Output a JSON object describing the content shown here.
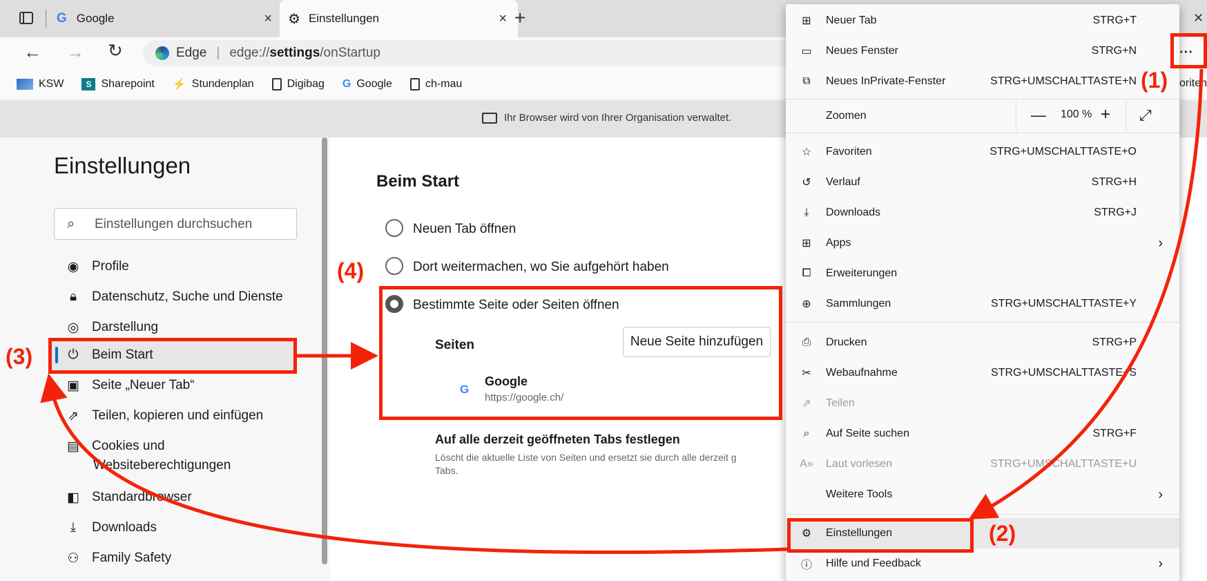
{
  "tabs": [
    {
      "label": "Google",
      "close": "×"
    },
    {
      "label": "Einstellungen",
      "close": "×"
    }
  ],
  "new_tab_symbol": "+",
  "window_close": "✕",
  "address": {
    "brand": "Edge",
    "separator": "|",
    "url_prefix": "edge://",
    "url_bold": "settings",
    "url_rest": "/onStartup"
  },
  "more_button_label": "···",
  "favorites": [
    "KSW",
    "Sharepoint",
    "Stundenplan",
    "Digibag",
    "Google",
    "ch-mau"
  ],
  "favorites_right_cutoff": "voriten",
  "managed_notice": "Ihr Browser wird von Ihrer Organisation verwaltet.",
  "settings": {
    "title": "Einstellungen",
    "search_placeholder": "Einstellungen durchsuchen",
    "nav": [
      {
        "label": "Profile",
        "icon": "profile-icon"
      },
      {
        "label": "Datenschutz, Suche und Dienste",
        "icon": "lock-icon"
      },
      {
        "label": "Darstellung",
        "icon": "palette-icon"
      },
      {
        "label": "Beim Start",
        "icon": "power-icon",
        "active": true
      },
      {
        "label": "Seite „Neuer Tab“",
        "icon": "newtab-icon"
      },
      {
        "label": "Teilen, kopieren und einfügen",
        "icon": "share-icon"
      },
      {
        "label": "Cookies und",
        "label2": "Websiteberechtigungen",
        "icon": "cookie-icon"
      },
      {
        "label": "Standardbrowser",
        "icon": "browser-icon"
      },
      {
        "label": "Downloads",
        "icon": "download-icon"
      },
      {
        "label": "Family Safety",
        "icon": "family-icon"
      }
    ]
  },
  "startup": {
    "heading": "Beim Start",
    "options": [
      {
        "label": "Neuen Tab öffnen",
        "selected": false
      },
      {
        "label": "Dort weitermachen, wo Sie aufgehört haben",
        "selected": false
      },
      {
        "label": "Bestimmte Seite oder Seiten öffnen",
        "selected": true
      }
    ],
    "pages_label": "Seiten",
    "add_page_button": "Neue Seite hinzufügen",
    "page_entry": {
      "title": "Google",
      "url": "https://google.ch/"
    },
    "set_all_title": "Auf alle derzeit geöffneten Tabs festlegen",
    "set_all_desc_line1": "Löscht die aktuelle Liste von Seiten und ersetzt sie durch alle derzeit g",
    "set_all_desc_line2": "Tabs."
  },
  "menu": {
    "items": [
      {
        "label": "Neuer Tab",
        "shortcut": "STRG+T",
        "icon": "new-tab-icon"
      },
      {
        "label": "Neues Fenster",
        "shortcut": "STRG+N",
        "icon": "window-icon"
      },
      {
        "label": "Neues InPrivate-Fenster",
        "shortcut": "STRG+UMSCHALTTASTE+N",
        "icon": "inprivate-icon"
      },
      {
        "label": "Favoriten",
        "shortcut": "STRG+UMSCHALTTASTE+O",
        "icon": "favorites-icon"
      },
      {
        "label": "Verlauf",
        "shortcut": "STRG+H",
        "icon": "history-icon"
      },
      {
        "label": "Downloads",
        "shortcut": "STRG+J",
        "icon": "download-icon"
      },
      {
        "label": "Apps",
        "shortcut": "",
        "icon": "apps-icon",
        "submenu": true
      },
      {
        "label": "Erweiterungen",
        "shortcut": "",
        "icon": "extensions-icon"
      },
      {
        "label": "Sammlungen",
        "shortcut": "STRG+UMSCHALTTASTE+Y",
        "icon": "collections-icon"
      },
      {
        "label": "Drucken",
        "shortcut": "STRG+P",
        "icon": "print-icon"
      },
      {
        "label": "Webaufnahme",
        "shortcut": "STRG+UMSCHALTTASTE+S",
        "icon": "capture-icon"
      },
      {
        "label": "Teilen",
        "shortcut": "",
        "icon": "share-icon",
        "disabled": true
      },
      {
        "label": "Auf Seite suchen",
        "shortcut": "STRG+F",
        "icon": "find-icon"
      },
      {
        "label": "Laut vorlesen",
        "shortcut": "STRG+UMSCHALTTASTE+U",
        "icon": "read-aloud-icon",
        "disabled": true
      },
      {
        "label": "Weitere Tools",
        "shortcut": "",
        "icon": "",
        "submenu": true
      },
      {
        "label": "Einstellungen",
        "shortcut": "",
        "icon": "gear-icon",
        "highlight": true
      },
      {
        "label": "Hilfe und Feedback",
        "shortcut": "",
        "icon": "help-icon",
        "submenu": true
      }
    ],
    "zoom": {
      "label": "Zoomen",
      "value": "100 %",
      "minus": "—",
      "plus": "+"
    }
  },
  "annotations": [
    "(1)",
    "(2)",
    "(3)",
    "(4)"
  ],
  "colors": {
    "annotation_red": "#f3230a",
    "active_indicator": "#0f6cbd"
  }
}
